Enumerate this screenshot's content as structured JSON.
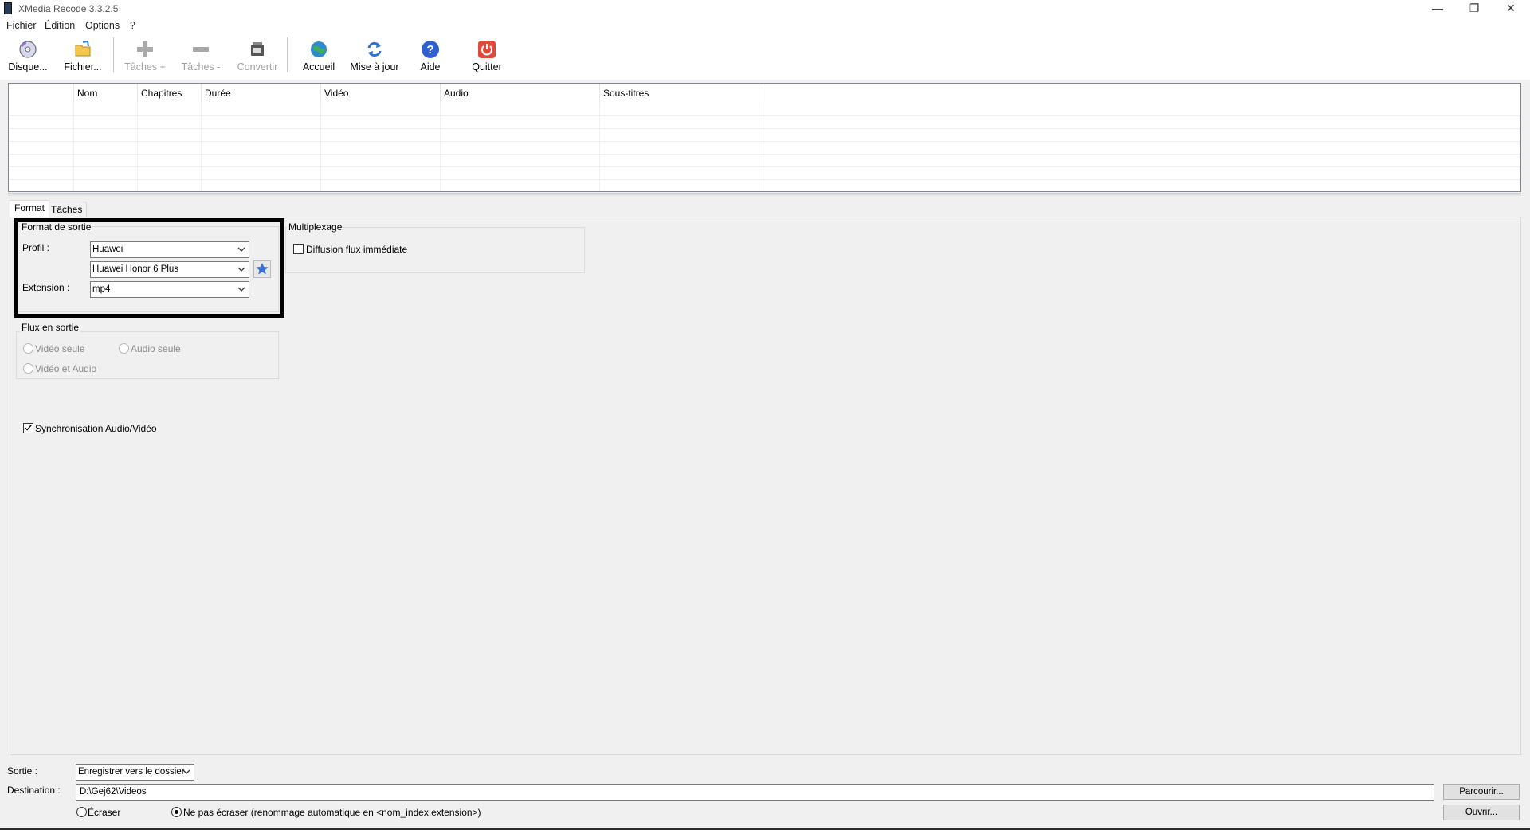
{
  "window": {
    "title": "XMedia Recode 3.3.2.5",
    "controls": {
      "minimize": "—",
      "restore": "❐",
      "close": "✕"
    }
  },
  "menu": {
    "items": [
      "Fichier",
      "Édition",
      "Options",
      "?"
    ]
  },
  "toolbar": {
    "buttons": [
      {
        "label": "Disque...",
        "icon": "disc-icon",
        "enabled": true
      },
      {
        "label": "Fichier...",
        "icon": "open-file-icon",
        "enabled": true
      },
      {
        "label": "Tâches +",
        "icon": "plus-icon",
        "enabled": false
      },
      {
        "label": "Tâches -",
        "icon": "minus-icon",
        "enabled": false
      },
      {
        "label": "Convertir",
        "icon": "convert-icon",
        "enabled": false
      },
      {
        "label": "Accueil",
        "icon": "globe-icon",
        "enabled": true
      },
      {
        "label": "Mise à jour",
        "icon": "refresh-icon",
        "enabled": true
      },
      {
        "label": "Aide",
        "icon": "help-icon",
        "enabled": true
      },
      {
        "label": "Quitter",
        "icon": "power-icon",
        "enabled": true
      }
    ]
  },
  "filelist": {
    "columns": [
      "Nom",
      "Chapitres",
      "Durée",
      "Vidéo",
      "Audio",
      "Sous-titres"
    ]
  },
  "tabs": [
    "Format",
    "Tâches"
  ],
  "format": {
    "output_group_title": "Format de sortie",
    "profile_label": "Profil :",
    "profile_value": "Huawei",
    "device_value": "Huawei Honor 6 Plus",
    "extension_label": "Extension :",
    "extension_value": "mp4",
    "mux_group_title": "Multiplexage",
    "immediate_stream_label": "Diffusion flux immédiate",
    "immediate_stream_checked": false,
    "stream_group_title": "Flux en sortie",
    "video_only_label": "Vidéo seule",
    "audio_only_label": "Audio seule",
    "video_audio_label": "Vidéo et Audio",
    "sync_label": "Synchronisation Audio/Vidéo",
    "sync_checked": true
  },
  "output": {
    "sortie_label": "Sortie :",
    "sortie_value": "Enregistrer vers le dossier",
    "destination_label": "Destination :",
    "destination_value": "D:\\Gej62\\Videos",
    "browse_button": "Parcourir...",
    "open_button": "Ouvrir...",
    "overwrite_label": "Écraser",
    "no_overwrite_label": "Ne pas écraser (renommage automatique en <nom_index.extension>)",
    "overwrite_selected": "no_overwrite"
  },
  "colors": {
    "accent_highlight": "#000000",
    "quit_red": "#e04a3a",
    "help_blue": "#2f5fd0",
    "star_blue": "#3a6fd8"
  }
}
